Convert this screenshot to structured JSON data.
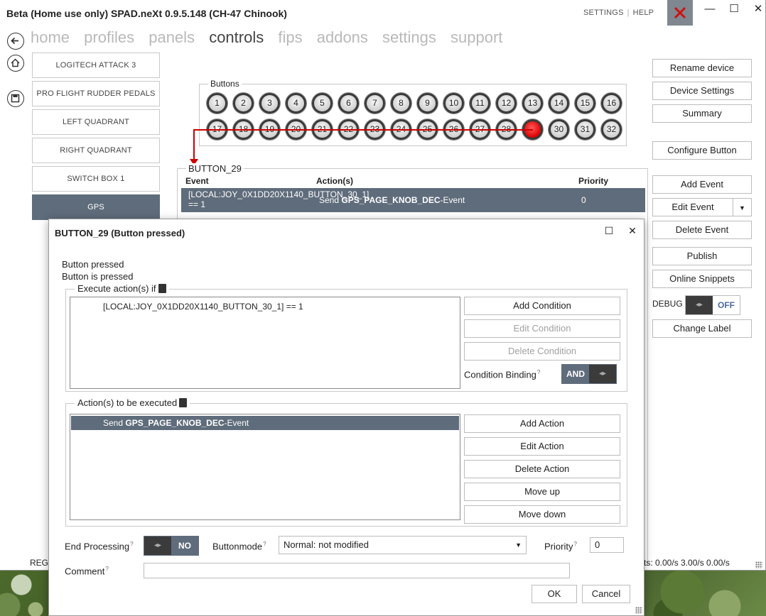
{
  "window": {
    "title": "Beta (Home use only) SPAD.neXt 0.9.5.148 (CH-47 Chinook)",
    "links": [
      "SETTINGS",
      "HELP"
    ],
    "controls": {
      "minimize": "—",
      "maximize": "☐",
      "close": "✕"
    }
  },
  "nav": {
    "items": [
      "home",
      "profiles",
      "panels",
      "controls",
      "fips",
      "addons",
      "settings",
      "support"
    ],
    "active": "controls"
  },
  "devices": [
    {
      "label": "LOGITECH ATTACK 3",
      "active": false
    },
    {
      "label": "PRO FLIGHT RUDDER PEDALS",
      "active": false
    },
    {
      "label": "LEFT QUADRANT",
      "active": false
    },
    {
      "label": "RIGHT QUADRANT",
      "active": false
    },
    {
      "label": "SWITCH BOX 1",
      "active": false
    },
    {
      "label": "GPS",
      "active": true
    }
  ],
  "buttons_panel": {
    "label": "Buttons",
    "row1": [
      "1",
      "2",
      "3",
      "4",
      "5",
      "6",
      "7",
      "8",
      "9",
      "10",
      "11",
      "12",
      "13",
      "14",
      "15",
      "16"
    ],
    "row2": [
      "17",
      "18",
      "19",
      "20",
      "21",
      "22",
      "23",
      "24",
      "25",
      "26",
      "27",
      "28",
      "",
      "30",
      "31",
      "32"
    ],
    "pressed_index": 28
  },
  "events": {
    "title": "BUTTON_29",
    "headers": {
      "event": "Event",
      "actions": "Action(s)",
      "priority": "Priority"
    },
    "row": {
      "event": "[LOCAL:JOY_0X1DD20X1140_BUTTON_30_1] == 1",
      "action_prefix": "Send ",
      "action_name": "GPS_PAGE_KNOB_DEC",
      "action_suffix": "-Event",
      "priority": "0"
    }
  },
  "right_buttons": {
    "rename": "Rename device",
    "device_settings": "Device Settings",
    "summary": "Summary",
    "configure": "Configure Button",
    "add_event": "Add Event",
    "edit_event": "Edit Event",
    "delete_event": "Delete Event",
    "publish": "Publish",
    "snippets": "Online Snippets",
    "debug_label": "DEBUG",
    "debug_value": "OFF",
    "change_label": "Change Label"
  },
  "status": {
    "left": "REG",
    "right": "ts: 0.00/s 3.00/s 0.00/s"
  },
  "dialog": {
    "title": "BUTTON_29 (Button pressed)",
    "line1": "Button pressed",
    "line2": "Button is pressed",
    "conditions": {
      "label": "Execute action(s) if",
      "items": [
        "[LOCAL:JOY_0X1DD20X1140_BUTTON_30_1] == 1"
      ],
      "add": "Add Condition",
      "edit": "Edit Condition",
      "delete": "Delete Condition",
      "binding_label": "Condition Binding",
      "binding_value": "AND"
    },
    "actions": {
      "label": "Action(s) to be executed",
      "item_prefix": "Send ",
      "item_name": "GPS_PAGE_KNOB_DEC",
      "item_suffix": "-Event",
      "add": "Add Action",
      "edit": "Edit Action",
      "delete": "Delete Action",
      "up": "Move up",
      "down": "Move down"
    },
    "end_processing_label": "End Processing",
    "end_processing_value": "NO",
    "buttonmode_label": "Buttonmode",
    "buttonmode_value": "Normal: not modified",
    "priority_label": "Priority",
    "priority_value": "0",
    "comment_label": "Comment",
    "comment_value": "",
    "ok": "OK",
    "cancel": "Cancel"
  }
}
